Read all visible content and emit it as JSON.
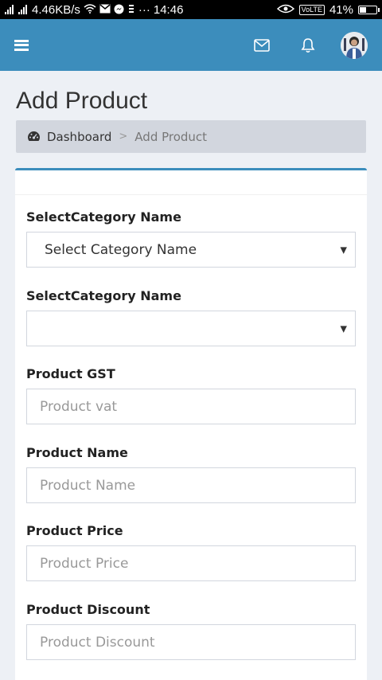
{
  "status_bar": {
    "net_speed": "4.46KB/s",
    "time": "14:46",
    "volte": "VoLTE",
    "battery_text": "41%",
    "battery_level": 0.41,
    "more": "···"
  },
  "header": {
    "menu_icon": "hamburger-icon",
    "mail_icon": "envelope-icon",
    "bell_icon": "bell-icon"
  },
  "page": {
    "title": "Add Product",
    "breadcrumb": {
      "home_label": "Dashboard",
      "separator": ">",
      "current_label": "Add Product"
    }
  },
  "form": {
    "fields": [
      {
        "label": "SelectCategory Name",
        "type": "select",
        "value": "Select Category Name"
      },
      {
        "label": "SelectCategory Name",
        "type": "select",
        "value": ""
      },
      {
        "label": "Product GST",
        "type": "input",
        "placeholder": "Product vat"
      },
      {
        "label": "Product Name",
        "type": "input",
        "placeholder": "Product Name"
      },
      {
        "label": "Product Price",
        "type": "input",
        "placeholder": "Product Price"
      },
      {
        "label": "Product Discount",
        "type": "input",
        "placeholder": "Product Discount"
      }
    ]
  },
  "colors": {
    "accent": "#3c8dbc",
    "background": "#edf0f5",
    "breadcrumb_bg": "#d2d6de"
  }
}
